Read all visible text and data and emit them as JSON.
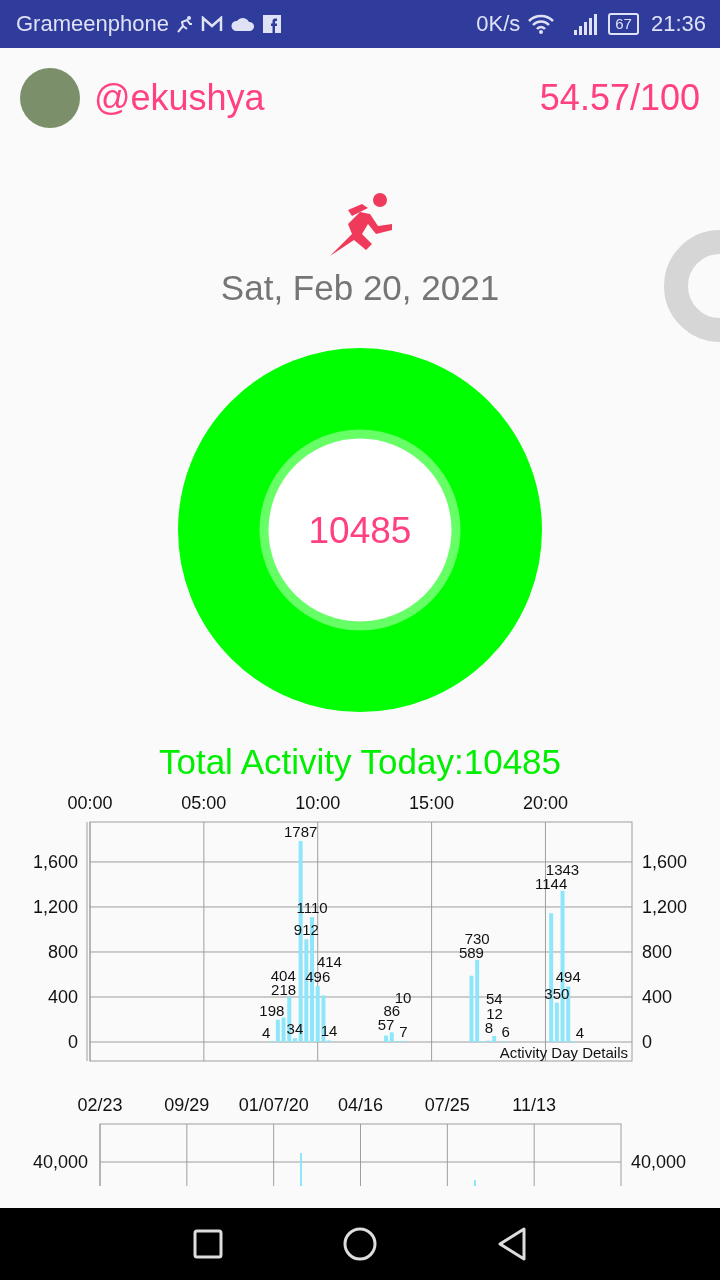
{
  "status_bar": {
    "carrier": "Grameenphone",
    "speed": "0K/s",
    "battery": "67",
    "time": "21:36"
  },
  "header": {
    "username": "@ekushya",
    "score": "54.57/100"
  },
  "date": "Sat, Feb 20, 2021",
  "ring": {
    "value": "10485",
    "level": 1
  },
  "total_label": "Total Activity Today:10485",
  "day_chart": {
    "description": "Activity Day Details",
    "chart_data": {
      "type": "bar",
      "data_labels": true,
      "grid": true,
      "xlim": [
        0,
        23.8
      ],
      "ylim": [
        0,
        1955
      ],
      "xticks": [
        {
          "value": 0,
          "label": "00:00"
        },
        {
          "value": 5,
          "label": "05:00"
        },
        {
          "value": 10,
          "label": "10:00"
        },
        {
          "value": 15,
          "label": "15:00"
        },
        {
          "value": 20,
          "label": "20:00"
        }
      ],
      "yticks": [
        {
          "value": 0,
          "label": "0"
        },
        {
          "value": 400,
          "label": "400"
        },
        {
          "value": 800,
          "label": "800"
        },
        {
          "value": 1200,
          "label": "1,200"
        },
        {
          "value": 1600,
          "label": "1,600"
        }
      ],
      "x": [
        8.0,
        8.25,
        8.5,
        8.75,
        9.0,
        9.25,
        9.5,
        9.75,
        10.0,
        10.25,
        10.5,
        13.0,
        13.25,
        13.5,
        13.75,
        16.75,
        17.0,
        17.25,
        17.5,
        17.75,
        18.25,
        20.25,
        20.5,
        20.75,
        21.0,
        21.25
      ],
      "series": [
        {
          "color": "#8ee6fb",
          "values": [
            4,
            198,
            218,
            404,
            34,
            1787,
            912,
            1110,
            496,
            414,
            14,
            57,
            86,
            7,
            10,
            589,
            730,
            8,
            12,
            54,
            6,
            1144,
            350,
            1343,
            494,
            4
          ]
        }
      ]
    }
  },
  "history_chart": {
    "x_labels": [
      "02/23",
      "09/29",
      "01/07/20",
      "04/16",
      "07/25",
      "11/13"
    ],
    "y_labels": [
      "40,000",
      "40,000"
    ]
  }
}
